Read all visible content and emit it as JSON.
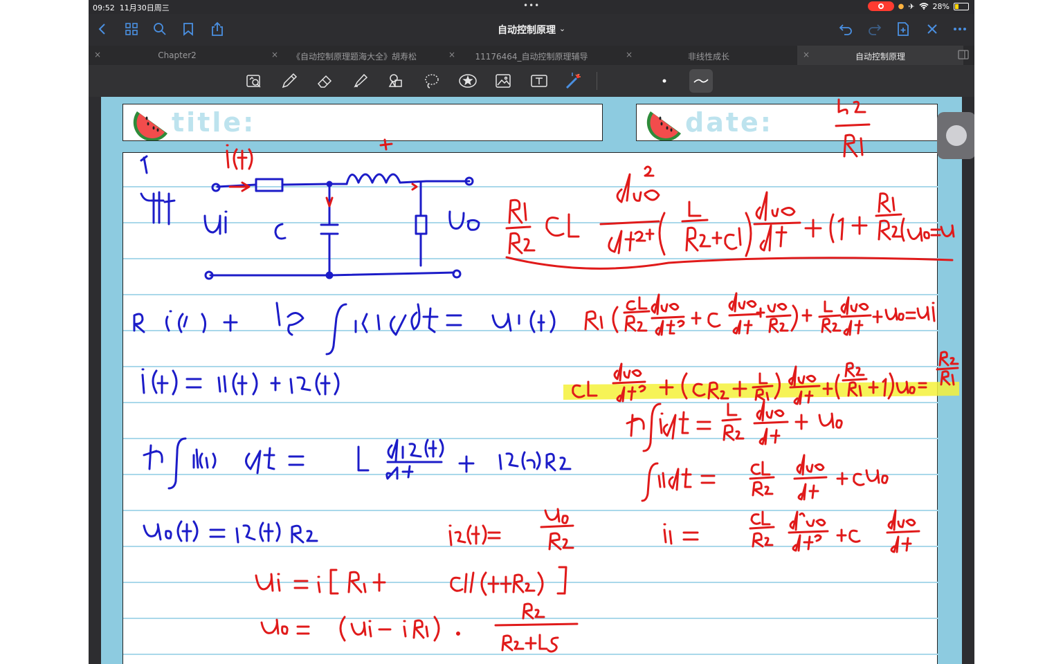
{
  "status_bar": {
    "time": "09:52",
    "date": "11月30日周三",
    "battery_text": "28%",
    "battery_level": 0.28,
    "multitask_dots": "•••"
  },
  "nav": {
    "title": "自动控制原理",
    "title_chevron": "⌄",
    "left_icons": [
      "back-chevron-icon",
      "grid-icon",
      "search-icon",
      "bookmark-icon",
      "share-icon"
    ],
    "right_icons": [
      "undo-icon",
      "redo-icon",
      "add-page-icon",
      "close-icon",
      "more-icon"
    ]
  },
  "tabs": [
    {
      "label": "Chapter2",
      "active": false
    },
    {
      "label": "《自动控制原理题海大全》胡寿松",
      "active": false
    },
    {
      "label": "11176464_自动控制原理辅导",
      "active": false
    },
    {
      "label": "非线性成长",
      "active": false
    },
    {
      "label": "自动控制原理",
      "active": true
    }
  ],
  "tab_close_glyph": "×",
  "toolbar": {
    "tools": [
      "zoom-box-icon",
      "pen-icon",
      "eraser-icon",
      "highlighter-icon",
      "shapes-icon",
      "lasso-icon",
      "sticker-icon",
      "image-icon",
      "text-icon",
      "laser-pointer-icon"
    ],
    "selected_tool": "wave-stroke-icon"
  },
  "page": {
    "title_label": "title:",
    "date_label": "date:"
  },
  "colors": {
    "app_bg": "#2d2d30",
    "accent_blue": "#4a90e2",
    "paper_bg": "#8dcbe0",
    "grid_line": "#a9d8ea",
    "ink_blue": "#1c1cc8",
    "ink_red": "#e01a1a",
    "highlight": "#f4f13a"
  }
}
